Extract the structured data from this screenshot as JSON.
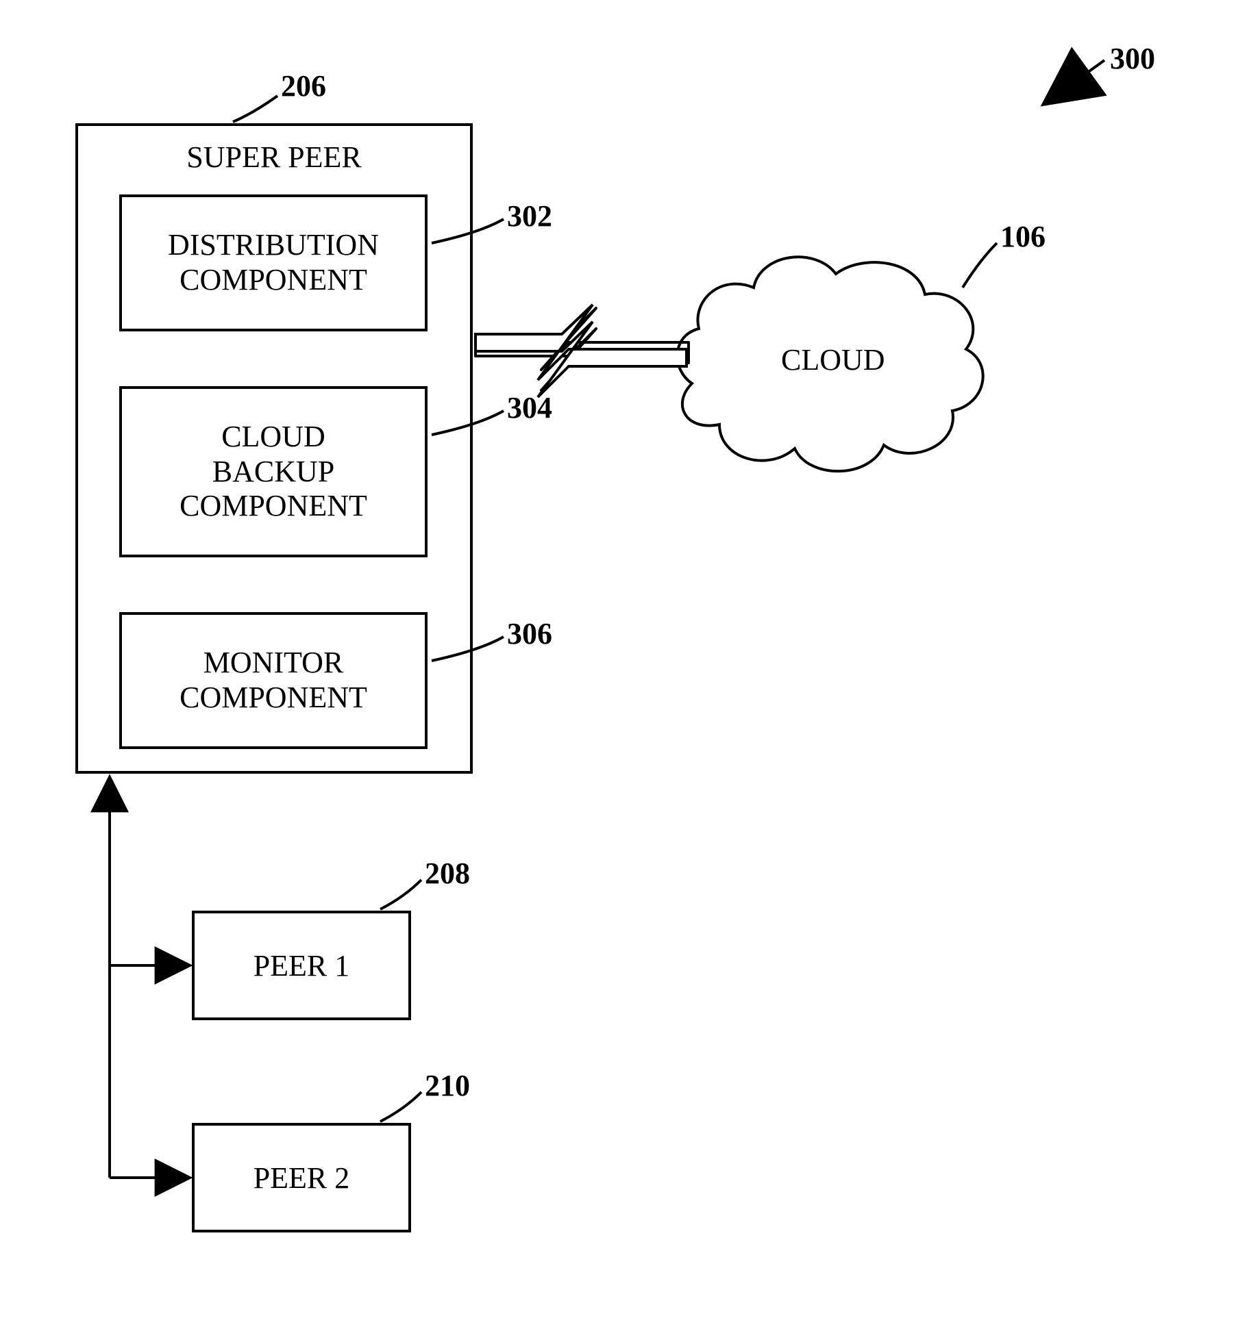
{
  "figure_ref": "300",
  "super_peer": {
    "ref": "206",
    "title": "SUPER PEER",
    "components": [
      {
        "label": "DISTRIBUTION\nCOMPONENT",
        "ref": "302"
      },
      {
        "label": "CLOUD\nBACKUP\nCOMPONENT",
        "ref": "304"
      },
      {
        "label": "MONITOR\nCOMPONENT",
        "ref": "306"
      }
    ]
  },
  "cloud": {
    "label": "CLOUD",
    "ref": "106"
  },
  "peers": [
    {
      "label": "PEER 1",
      "ref": "208"
    },
    {
      "label": "PEER 2",
      "ref": "210"
    }
  ]
}
